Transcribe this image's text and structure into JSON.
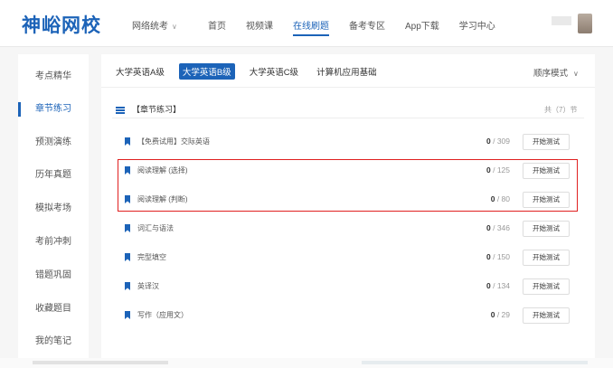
{
  "header": {
    "logo": "神峪网校",
    "dropdown_label": "网络统考",
    "nav": [
      "首页",
      "视频课",
      "在线刷题",
      "备考专区",
      "App下载",
      "学习中心"
    ],
    "active_nav": "在线刷题",
    "brand_color": "#1c63b8"
  },
  "sidebar": {
    "items": [
      "考点精华",
      "章节练习",
      "预测演练",
      "历年真题",
      "模拟考场",
      "考前冲刺",
      "错题巩固",
      "收藏题目",
      "我的笔记"
    ],
    "active": "章节练习"
  },
  "main": {
    "subtabs": [
      "大学英语A级",
      "大学英语B级",
      "大学英语C级",
      "计算机应用基础"
    ],
    "active_subtab": "大学英语B级",
    "sort_label": "顺序模式",
    "section_title": "【章节练习】",
    "section_count": "共（7）节",
    "button_label": "开始测试",
    "rows": [
      {
        "title": "【免费试用】交际英语",
        "done": "0",
        "total": "/ 309"
      },
      {
        "title": "阅读理解 (选择)",
        "done": "0",
        "total": "/ 125"
      },
      {
        "title": "阅读理解 (判断)",
        "done": "0",
        "total": "/ 80"
      },
      {
        "title": "词汇与语法",
        "done": "0",
        "total": "/ 346"
      },
      {
        "title": "完型填空",
        "done": "0",
        "total": "/ 150"
      },
      {
        "title": "英译汉",
        "done": "0",
        "total": "/ 134"
      },
      {
        "title": "写作（应用文）",
        "done": "0",
        "total": "/ 29"
      }
    ],
    "highlight_color": "#e02020"
  }
}
